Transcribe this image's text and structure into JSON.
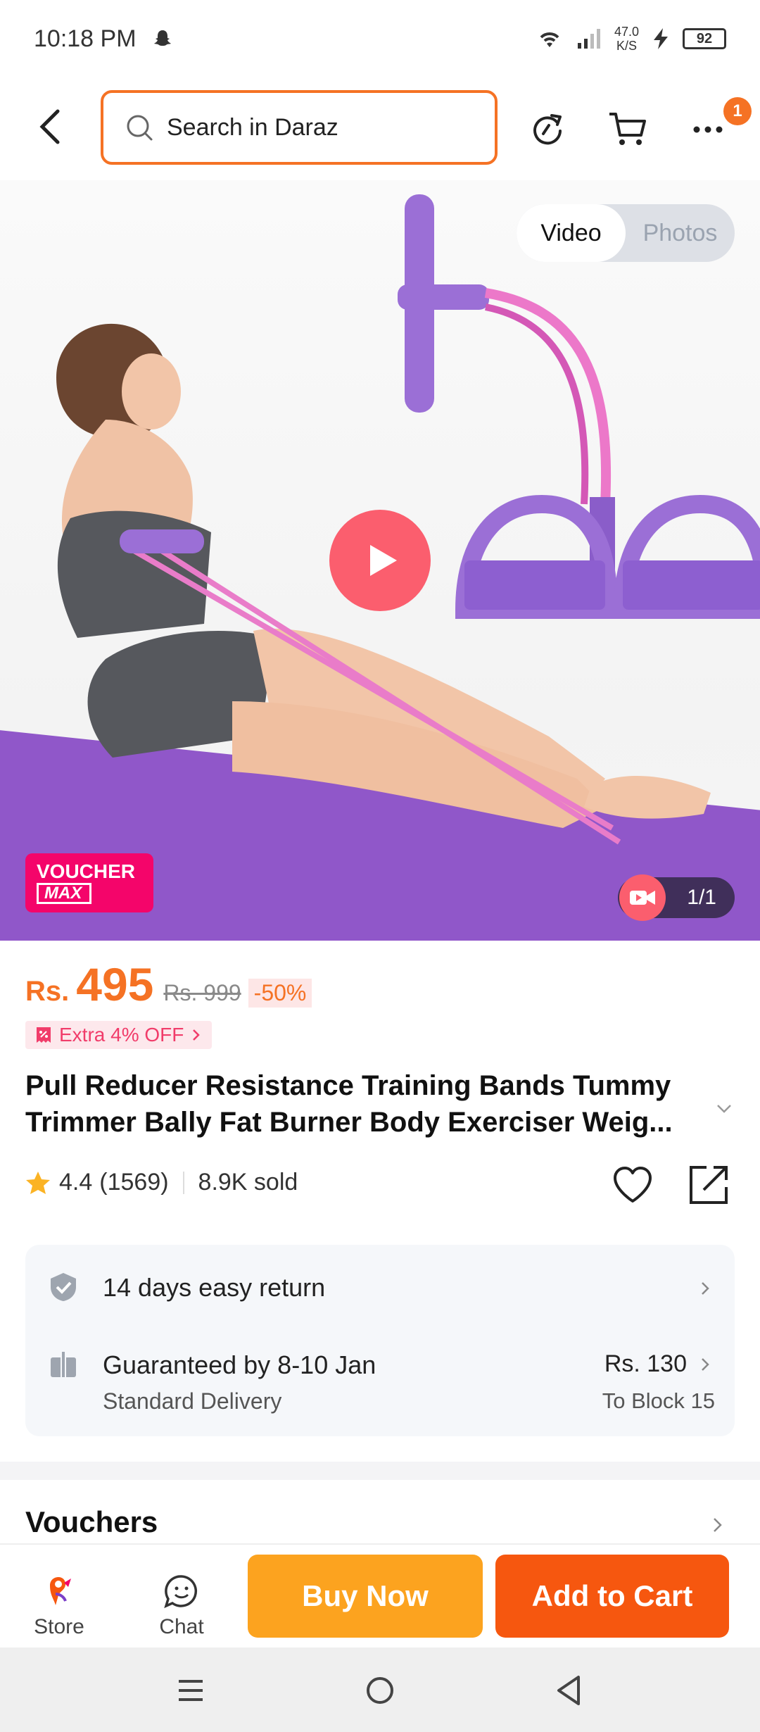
{
  "status_bar": {
    "time": "10:18 PM",
    "speed_value": "47.0",
    "speed_unit": "K/S",
    "battery": "92"
  },
  "header": {
    "search_placeholder": "Search in Daraz",
    "more_badge": "1"
  },
  "hero": {
    "toggle": {
      "video_label": "Video",
      "photos_label": "Photos",
      "active": "Video"
    },
    "voucher_line1": "VOUCHER",
    "voucher_line2": "MAX",
    "counter": "1/1"
  },
  "product": {
    "currency": "Rs.",
    "price": "495",
    "original_price": "Rs. 999",
    "discount": "-50%",
    "extra_offer": "Extra 4% OFF",
    "title": "Pull Reducer Resistance Training Bands Tummy Trimmer Bally Fat Burner Body Exerciser Weig...",
    "rating": "4.4",
    "rating_count": "(1569)",
    "sold": "8.9K sold"
  },
  "delivery": {
    "return_text": "14 days easy return",
    "guarantee_text": "Guaranteed by 8-10 Jan",
    "delivery_type": "Standard Delivery",
    "fee": "Rs. 130",
    "destination": "To Block 15"
  },
  "vouchers_heading": "Vouchers",
  "bottom_bar": {
    "store_label": "Store",
    "chat_label": "Chat",
    "buy_now": "Buy Now",
    "add_to_cart": "Add to Cart"
  },
  "colors": {
    "accent": "#f57224",
    "buy_now": "#fca31f",
    "add_to_cart": "#f6570f",
    "voucher": "#f4056a"
  }
}
